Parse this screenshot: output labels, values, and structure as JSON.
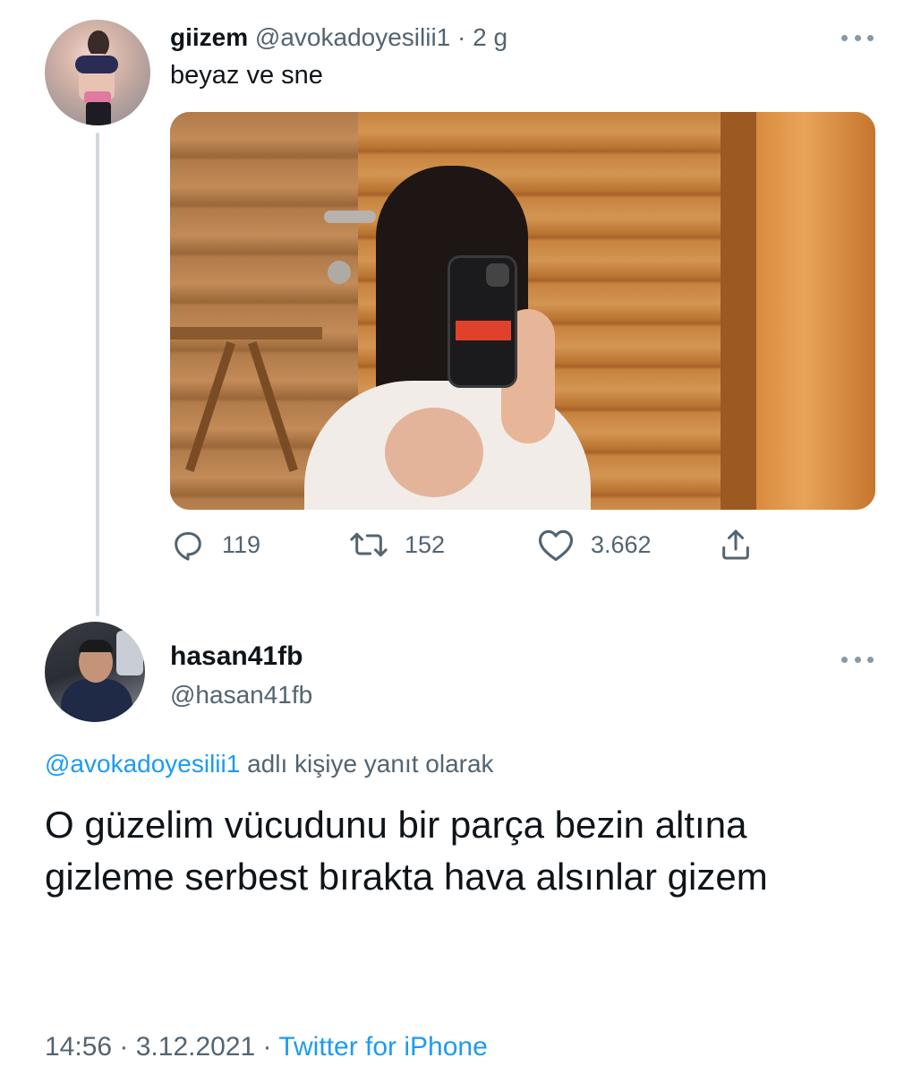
{
  "tweet1": {
    "display_name": "giizem",
    "handle": "@avokadoyesilii1",
    "separator": " · ",
    "age": "2 g",
    "text": "beyaz ve sne",
    "stats": {
      "replies": "119",
      "retweets": "152",
      "likes": "3.662"
    },
    "icons": {
      "reply": "reply-icon",
      "retweet": "retweet-icon",
      "like": "heart-icon",
      "share": "share-icon",
      "more": "more-dots-icon"
    }
  },
  "tweet2": {
    "display_name": "hasan41fb",
    "handle": "@hasan41fb",
    "reply_mention": "@avokadoyesilii1",
    "reply_suffix": " adlı kişiye yanıt olarak",
    "text": "O güzelim vücudunu bir parça bezin altına gizleme serbest bırakta hava alsınlar gizem",
    "time": "14:56",
    "date": "3.12.2021",
    "source": "Twitter for iPhone",
    "meta_separator": " · "
  },
  "colors": {
    "text_primary": "#0f1419",
    "text_secondary": "#536471",
    "accent_blue": "#1d9bf0",
    "thread_line": "#cfd9de"
  }
}
